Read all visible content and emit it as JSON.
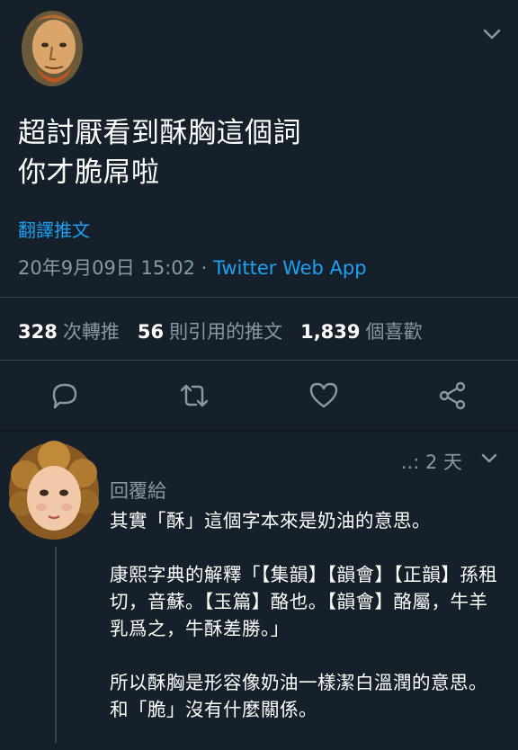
{
  "tweet": {
    "text_line1": "超討厭看到酥胸這個詞",
    "text_line2": "你才脆屌啦",
    "translate_label": "翻譯推文",
    "timestamp": "20年9月09日 15:02",
    "separator": " · ",
    "source": "Twitter Web App",
    "stats": {
      "retweets_count": "328",
      "retweets_label": "次轉推",
      "quotes_count": "56",
      "quotes_label": "則引用的推文",
      "likes_count": "1,839",
      "likes_label": "個喜歡"
    }
  },
  "reply": {
    "time_prefix": "..: ",
    "time": "2 天",
    "reply_to_label": "回覆給",
    "paragraph1": "其實「酥」這個字本來是奶油的意思。",
    "paragraph2": "康熙字典的解釋「【集韻】【韻會】【正韻】孫租切，音蘇。【玉篇】酪也。【韻會】酪屬，牛羊乳爲之，牛酥差勝。」",
    "paragraph3": "所以酥胸是形容像奶油一樣潔白溫潤的意思。和「脆」沒有什麼關係。"
  },
  "icons": {
    "reply": "reply-icon",
    "retweet": "retweet-icon",
    "like": "heart-icon",
    "share": "share-icon",
    "more": "chevron-down-icon"
  },
  "colors": {
    "background": "#15202b",
    "text": "#ffffff",
    "muted": "#8899a6",
    "link": "#1da1f2",
    "divider": "#38444d"
  }
}
